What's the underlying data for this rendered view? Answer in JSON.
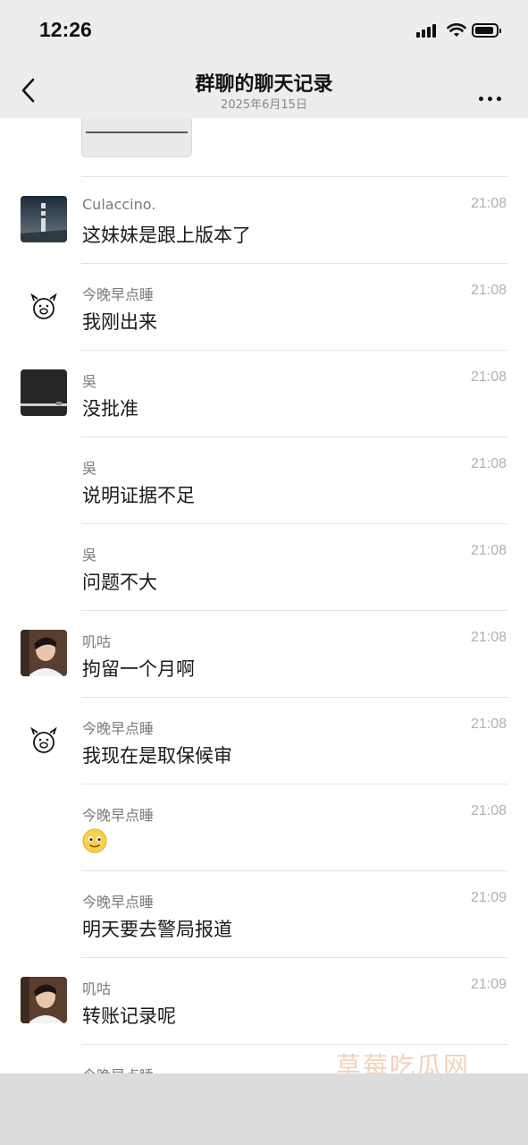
{
  "status": {
    "time": "12:26"
  },
  "header": {
    "title": "群聊的聊天记录",
    "subtitle": "2025年6月15日"
  },
  "messages": [
    {
      "name": "Culaccino.",
      "time": "21:08",
      "text": "这妹妹是跟上版本了",
      "avatar": "lighthouse-avatar"
    },
    {
      "name": "今晚早点睡",
      "time": "21:08",
      "text": "我刚出来",
      "avatar": "pig-face-avatar"
    },
    {
      "name": "吳",
      "time": "21:08",
      "text": "没批准",
      "avatar": "dark-avatar"
    },
    {
      "name": "吳",
      "time": "21:08",
      "text": "说明证据不足"
    },
    {
      "name": "吳",
      "time": "21:08",
      "text": "问题不大"
    },
    {
      "name": "叽咕",
      "time": "21:08",
      "text": "拘留一个月啊",
      "avatar": "portrait-avatar"
    },
    {
      "name": "今晚早点睡",
      "time": "21:08",
      "text": "我现在是取保候审",
      "avatar": "pig-face-avatar"
    },
    {
      "name": "今晚早点睡",
      "time": "21:08",
      "emoji": "smiling-face-emoji"
    },
    {
      "name": "今晚早点睡",
      "time": "21:09",
      "text": "明天要去警局报道"
    },
    {
      "name": "叽咕",
      "time": "21:09",
      "text": "转账记录呢",
      "avatar": "portrait-avatar"
    },
    {
      "name": "今晚早点睡",
      "time": "",
      "text": "",
      "avatar": "pig-face-avatar"
    }
  ],
  "watermark": "草莓吃瓜网",
  "colors": {
    "nav_bg": "#ededed",
    "divider": "#e3e3e3",
    "name": "#7a7a7a",
    "time": "#b0b0b0"
  }
}
